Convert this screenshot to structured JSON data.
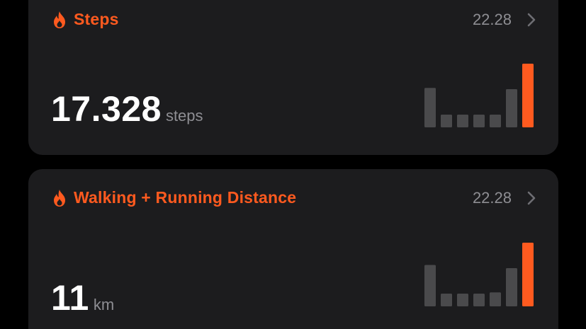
{
  "cards": [
    {
      "title": "Steps",
      "time": "22.28",
      "value": "17.328",
      "unit": "steps",
      "icon": "flame-icon",
      "accent_color": "#ff5a1f",
      "bar_color": "#4a4a4c",
      "bars": [
        0.62,
        0.2,
        0.2,
        0.2,
        0.2,
        0.6,
        1.0
      ]
    },
    {
      "title": "Walking + Running Distance",
      "time": "22.28",
      "value": "11",
      "unit": "km",
      "icon": "flame-icon",
      "accent_color": "#ff5a1f",
      "bar_color": "#4a4a4c",
      "bars": [
        0.65,
        0.2,
        0.2,
        0.2,
        0.22,
        0.6,
        1.0
      ]
    }
  ]
}
